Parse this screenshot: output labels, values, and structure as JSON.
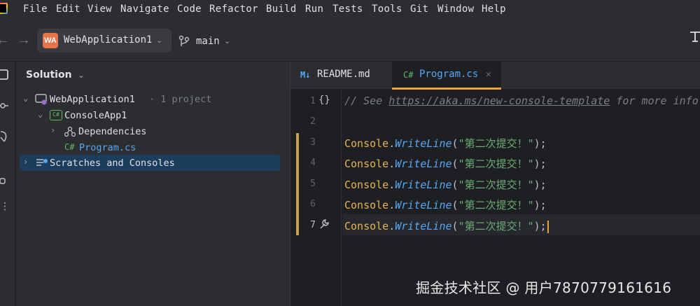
{
  "menu": [
    "File",
    "Edit",
    "View",
    "Navigate",
    "Code",
    "Refactor",
    "Build",
    "Run",
    "Tests",
    "Tools",
    "Git",
    "Window",
    "Help"
  ],
  "toolbar": {
    "project_badge": "WA",
    "project_name": "WebApplication1",
    "branch": "main"
  },
  "solution": {
    "header": "Solution",
    "tree": {
      "solution_name": "WebApplication1",
      "solution_meta": "· 1 project",
      "project": "ConsoleApp1",
      "dependencies": "Dependencies",
      "file_badge": "C#",
      "file": "Program.cs",
      "scratches": "Scratches and Consoles"
    }
  },
  "editor": {
    "tabs": [
      {
        "badge": "M↓",
        "label": "README.md"
      },
      {
        "badge": "C#",
        "label": "Program.cs"
      }
    ],
    "lines": [
      {
        "num": "1",
        "comment_prefix": "// See ",
        "link": "https://aka.ms/new-console-template",
        "comment_suffix": " for more info"
      },
      {
        "num": "2"
      },
      {
        "num": "3",
        "ident": "Console",
        "dot": ".",
        "method": "WriteLine",
        "open": "(",
        "str": "\"第二次提交！\"",
        "close": ");"
      },
      {
        "num": "4",
        "ident": "Console",
        "dot": ".",
        "method": "WriteLine",
        "open": "(",
        "str": "\"第二次提交！\"",
        "close": ");"
      },
      {
        "num": "5",
        "ident": "Console",
        "dot": ".",
        "method": "WriteLine",
        "open": "(",
        "str": "\"第二次提交！\"",
        "close": ");"
      },
      {
        "num": "6",
        "ident": "Console",
        "dot": ".",
        "method": "WriteLine",
        "open": "(",
        "str": "\"第二次提交！\"",
        "close": ");"
      },
      {
        "num": "7",
        "ident": "Console",
        "dot": ".",
        "method": "WriteLine",
        "open": "(",
        "str": "\"第二次提交！\"",
        "close": ");"
      }
    ],
    "gutter_symbol": "{}"
  },
  "watermark": "掘金技术社区 @ 用户7870779161616",
  "colors": {
    "accent": "#e8a33d",
    "badge": "#e8734b",
    "selection": "#1d3d5c"
  }
}
